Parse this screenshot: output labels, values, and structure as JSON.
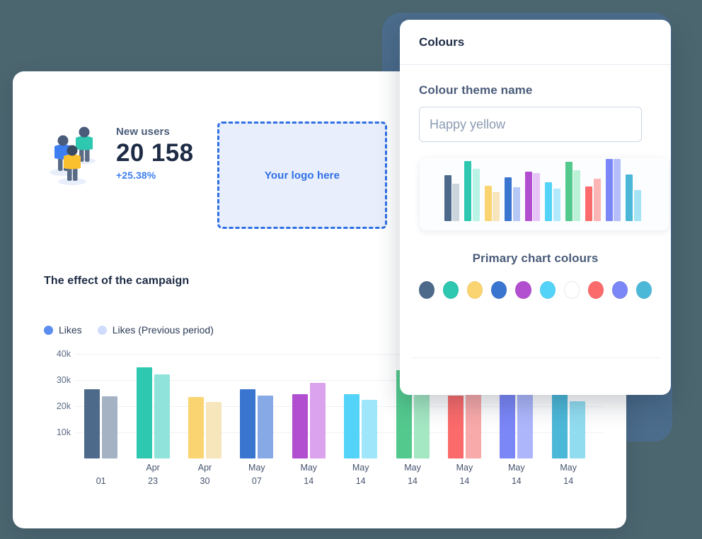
{
  "stats": {
    "label": "New users",
    "value": "20 158",
    "delta": "+25.38%"
  },
  "logo_drop": {
    "text": "Your logo here",
    "border_color": "#2f6fe4",
    "fill_color": "#e8eefc"
  },
  "campaign": {
    "title": "The effect of the campaign",
    "legend": [
      {
        "label": "Likes",
        "color": "#5b8def"
      },
      {
        "label": "Likes (Previous period)",
        "color": "#cfdcfb"
      }
    ]
  },
  "dialog": {
    "title": "Colours",
    "field_label": "Colour theme name",
    "theme_name_value": "Happy yellow",
    "theme_name_placeholder": "Happy yellow",
    "swatch_title": "Primary chart colours",
    "swatches": [
      {
        "name": "slate",
        "color": "#4d6a8b"
      },
      {
        "name": "teal",
        "color": "#2ec7b0"
      },
      {
        "name": "yellow",
        "color": "#fad471"
      },
      {
        "name": "blue",
        "color": "#3a75d0"
      },
      {
        "name": "purple",
        "color": "#b24fd0"
      },
      {
        "name": "cyan",
        "color": "#53d3f7"
      },
      {
        "name": "white",
        "color": "#ffffff"
      },
      {
        "name": "red",
        "color": "#fb6b6b"
      },
      {
        "name": "periwinkle",
        "color": "#7b86f7"
      },
      {
        "name": "light-blue",
        "color": "#4cb8d8"
      }
    ]
  },
  "chart_data": {
    "type": "bar",
    "title": "The effect of the campaign",
    "xlabel": "",
    "ylabel": "",
    "ylim": [
      0,
      40000
    ],
    "yticks": [
      "10k",
      "20k",
      "30k",
      "40k"
    ],
    "ytick_values": [
      10000,
      20000,
      30000,
      40000
    ],
    "grid": true,
    "legend_position": "top-left",
    "categories": [
      "01",
      "Apr 23",
      "Apr 30",
      "May 07",
      "May 14",
      "May 14",
      "May 14",
      "May 14",
      "May 14",
      "May 14"
    ],
    "category_lines": [
      [
        "",
        "01"
      ],
      [
        "Apr",
        "23"
      ],
      [
        "Apr",
        "30"
      ],
      [
        "May",
        "07"
      ],
      [
        "May",
        "14"
      ],
      [
        "May",
        "14"
      ],
      [
        "May",
        "14"
      ],
      [
        "May",
        "14"
      ],
      [
        "May",
        "14"
      ],
      [
        "May",
        "14"
      ]
    ],
    "series": [
      {
        "name": "Likes",
        "values": [
          26500,
          34800,
          23400,
          26500,
          24700,
          24700,
          33900,
          24000,
          28800,
          28800
        ]
      },
      {
        "name": "Likes (Previous period)",
        "values": [
          23900,
          32200,
          21700,
          24000,
          28800,
          22400,
          30000,
          28800,
          28800,
          21900
        ]
      }
    ],
    "series_colors": [
      [
        "#4d6a8b",
        "#a4b2c4"
      ],
      [
        "#2ec7b0",
        "#8fe3db"
      ],
      [
        "#fad471",
        "#f7e5bb"
      ],
      [
        "#3a75d0",
        "#87a9e6"
      ],
      [
        "#b24fd0",
        "#dba3ee"
      ],
      [
        "#53d3f7",
        "#9fe6fb"
      ],
      [
        "#53c98e",
        "#a4e7c3"
      ],
      [
        "#fb6b6b",
        "#f8a9a9"
      ],
      [
        "#7b86f7",
        "#adb6fb"
      ],
      [
        "#4cb8d8",
        "#92dcf0"
      ]
    ]
  },
  "preview_chart": {
    "type": "bar",
    "pairs": [
      {
        "primary_h": 65,
        "secondary_h": 53,
        "primary": "#4d6a8b",
        "secondary": "#ccd4de"
      },
      {
        "primary_h": 85,
        "secondary_h": 74,
        "primary": "#2ec7b0",
        "secondary": "#b9f4e6"
      },
      {
        "primary_h": 50,
        "secondary_h": 41,
        "primary": "#fad471",
        "secondary": "#f7e5bb"
      },
      {
        "primary_h": 62,
        "secondary_h": 48,
        "primary": "#3a75d0",
        "secondary": "#b6c8f5"
      },
      {
        "primary_h": 70,
        "secondary_h": 68,
        "primary": "#b24fd0",
        "secondary": "#e6c6f8"
      },
      {
        "primary_h": 55,
        "secondary_h": 46,
        "primary": "#53d3f7",
        "secondary": "#b2e9fc"
      },
      {
        "primary_h": 84,
        "secondary_h": 72,
        "primary": "#53c98e",
        "secondary": "#bbf2d7"
      },
      {
        "primary_h": 49,
        "secondary_h": 60,
        "primary": "#fb6b6b",
        "secondary": "#fbb5b5"
      },
      {
        "primary_h": 88,
        "secondary_h": 88,
        "primary": "#7b86f7",
        "secondary": "#b6bdfb"
      },
      {
        "primary_h": 66,
        "secondary_h": 44,
        "primary": "#4cb8d8",
        "secondary": "#a5e4f5"
      }
    ]
  },
  "illustration": {
    "name": "people-illustration",
    "figures": [
      {
        "body": "#3d7ef0",
        "head": "#4a5c7a"
      },
      {
        "body": "#2ec7b0",
        "head": "#4a5c7a"
      },
      {
        "body": "#fbc02d",
        "head": "#3a4a63"
      }
    ]
  },
  "colors": {
    "page_background": "#4c6670",
    "back_panel": "#4c6c8c",
    "card_background": "#ffffff",
    "accent": "#3d7ef0",
    "heading": "#1d2b45",
    "muted": "#4a5c7a"
  }
}
